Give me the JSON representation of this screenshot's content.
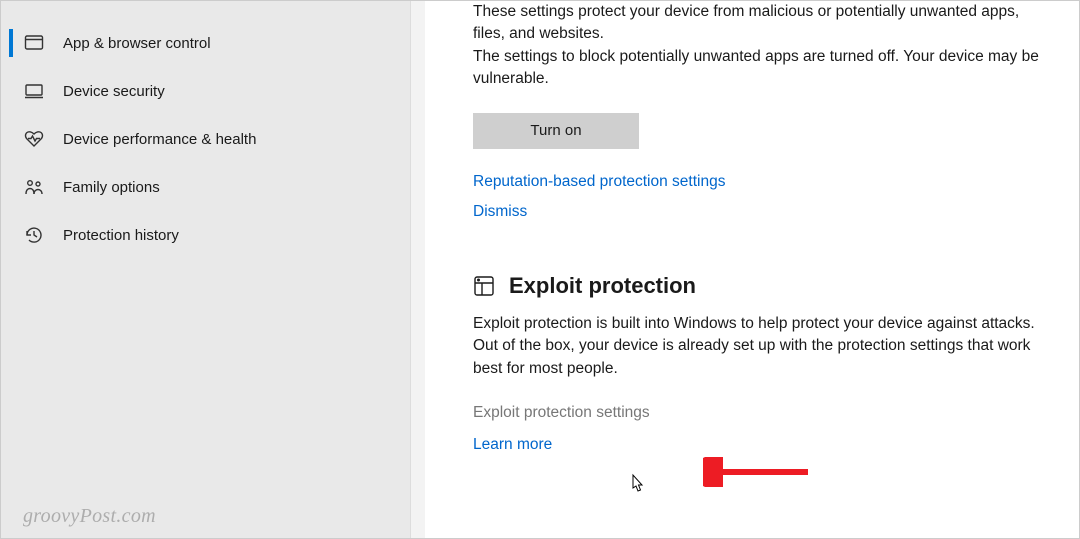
{
  "sidebar": {
    "items": [
      {
        "label": "App & browser control",
        "icon": "app-browser-icon",
        "active": true
      },
      {
        "label": "Device security",
        "icon": "device-security-icon",
        "active": false
      },
      {
        "label": "Device performance & health",
        "icon": "heart-icon",
        "active": false
      },
      {
        "label": "Family options",
        "icon": "family-icon",
        "active": false
      },
      {
        "label": "Protection history",
        "icon": "history-icon",
        "active": false
      }
    ]
  },
  "main": {
    "reputation": {
      "description1": "These settings protect your device from malicious or potentially unwanted apps, files, and websites.",
      "description2": "The settings to block potentially unwanted apps are turned off. Your device may be vulnerable.",
      "turn_on_button": "Turn on",
      "settings_link": "Reputation-based protection settings",
      "dismiss_link": "Dismiss"
    },
    "exploit": {
      "title": "Exploit protection",
      "description": "Exploit protection is built into Windows to help protect your device against attacks.  Out of the box, your device is already set up with the protection settings that work best for most people.",
      "settings_link": "Exploit protection settings",
      "learn_more_link": "Learn more"
    }
  },
  "watermark": "groovyPost.com"
}
